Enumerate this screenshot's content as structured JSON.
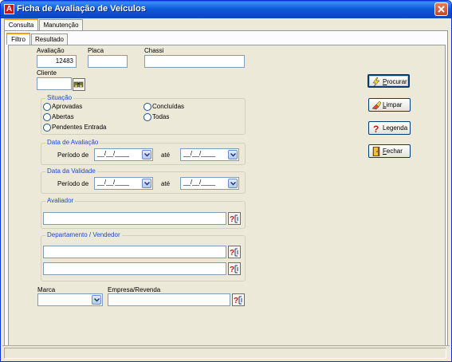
{
  "window": {
    "title": "Ficha de Avaliação de Veículos",
    "icon_letter": "A"
  },
  "main_tabs": [
    {
      "label": "Consulta",
      "active": true
    },
    {
      "label": "Manutenção",
      "active": false
    }
  ],
  "sub_tabs": [
    {
      "label": "Filtro",
      "active": true
    },
    {
      "label": "Resultado",
      "active": false
    }
  ],
  "fields": {
    "avaliacao": {
      "label": "Avaliação",
      "value": "12483"
    },
    "placa": {
      "label": "Placa",
      "value": ""
    },
    "chassi": {
      "label": "Chassi",
      "value": ""
    },
    "cliente": {
      "label": "Cliente",
      "value": ""
    }
  },
  "situacao": {
    "title": "Situação",
    "options": [
      "Aprovadas",
      "Concluídas",
      "Abertas",
      "Todas",
      "Pendentes Entrada"
    ],
    "selected": null
  },
  "data_avaliacao": {
    "title": "Data de Avaliação",
    "periodo_label": "Período de",
    "ate_label": "até",
    "from": "__/__/____",
    "to": "__/__/____"
  },
  "data_validade": {
    "title": "Data da Validade",
    "periodo_label": "Período de",
    "ate_label": "até",
    "from": "__/__/____",
    "to": "__/__/____"
  },
  "avaliador": {
    "title": "Avaliador",
    "value": ""
  },
  "departamento": {
    "title": "Departamento /  Vendedor",
    "departamento_value": "",
    "vendedor_value": ""
  },
  "marca": {
    "label": "Marca",
    "value": ""
  },
  "empresa": {
    "label": "Empresa/Revenda",
    "value": ""
  },
  "buttons": {
    "procurar": {
      "mnemonic": "P",
      "rest": "rocurar"
    },
    "limpar": {
      "mnemonic": "L",
      "rest": "impar"
    },
    "legenda": {
      "label": "Legenda"
    },
    "fechar": {
      "mnemonic": "F",
      "rest": "echar"
    }
  },
  "icons": {
    "lookup": "binoculars-icon",
    "help": "help-search-icon",
    "procurar": "lightning-icon",
    "limpar": "eraser-icon",
    "legenda": "question-icon",
    "fechar": "door-exit-icon"
  },
  "colors": {
    "titlebar": "#0a4bc8",
    "group_title": "#1b4bd0",
    "tab_highlight": "#ff9a00"
  }
}
